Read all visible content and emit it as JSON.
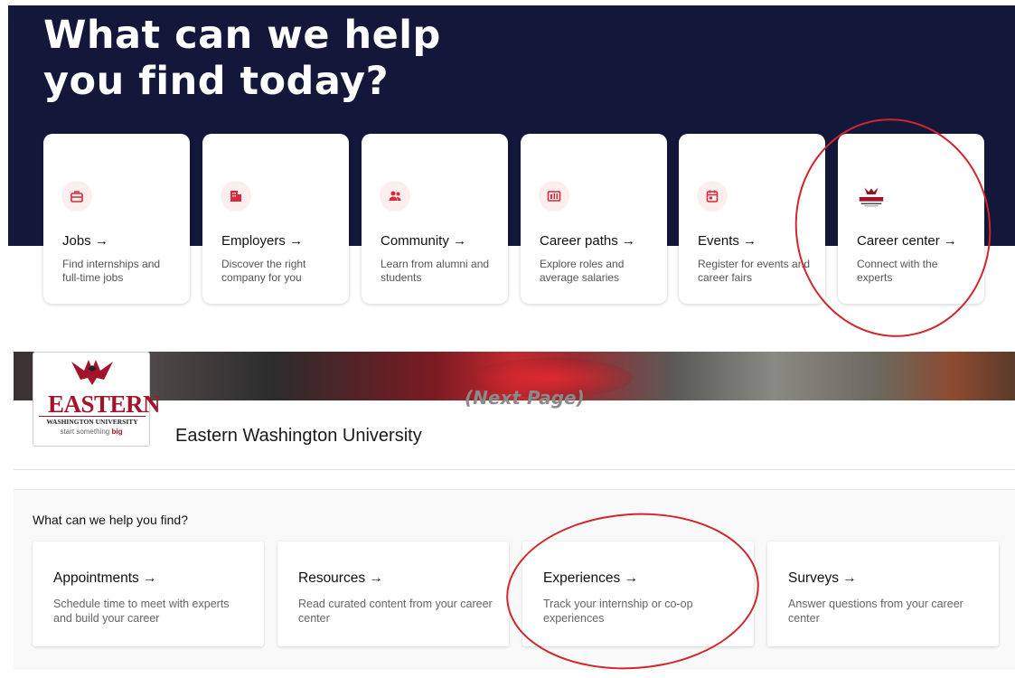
{
  "hero": {
    "title_line1": "What can we help",
    "title_line2": "you find today?"
  },
  "categories": [
    {
      "title": "Jobs →",
      "desc": "Find internships and full-time jobs",
      "icon": "briefcase-icon"
    },
    {
      "title": "Employers →",
      "desc": "Discover the right company for you",
      "icon": "building-icon"
    },
    {
      "title": "Community →",
      "desc": "Learn from alumni and students",
      "icon": "people-icon"
    },
    {
      "title": "Career paths →",
      "desc": "Explore roles and average salaries",
      "icon": "chart-icon"
    },
    {
      "title": "Events →",
      "desc": "Register for events and career fairs",
      "icon": "calendar-icon"
    },
    {
      "title": "Career center →",
      "desc": "Connect with the experts",
      "icon": "eastern-logo"
    }
  ],
  "annotation": {
    "next_page": "(Next Page)"
  },
  "university": {
    "name": "Eastern Washington University",
    "logo_wordmark": "EASTERN",
    "logo_subtitle": "WASHINGTON UNIVERSITY",
    "logo_tagline_prefix": "start something",
    "logo_tagline_emphasis": "big"
  },
  "help": {
    "title": "What can we help you find?",
    "cards": [
      {
        "title": "Appointments →",
        "desc": "Schedule time to meet with experts and build your career"
      },
      {
        "title": "Resources →",
        "desc": "Read curated content from your career center"
      },
      {
        "title": "Experiences →",
        "desc": "Track your internship or co-op experiences"
      },
      {
        "title": "Surveys →",
        "desc": "Answer questions from your career center"
      }
    ]
  },
  "colors": {
    "hero_bg": "#13173a",
    "accent": "#d72a3a",
    "annotation_circle": "#d0272e",
    "brand_red": "#a3142b"
  }
}
